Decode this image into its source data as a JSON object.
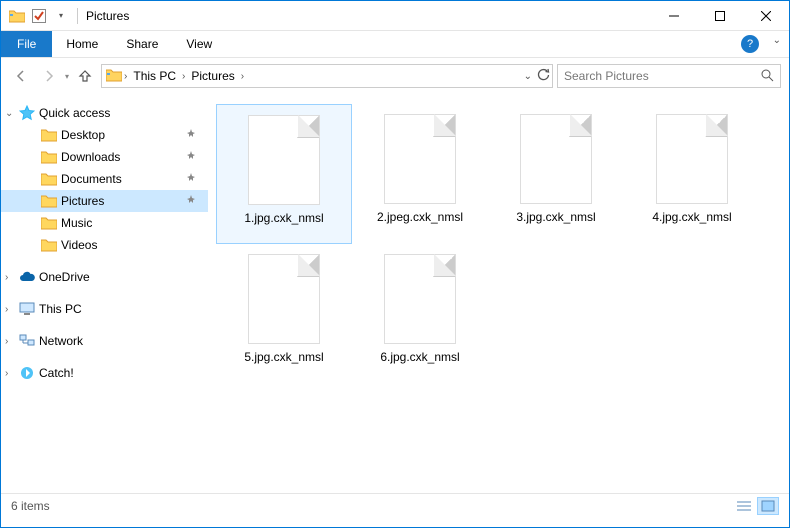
{
  "window": {
    "title": "Pictures"
  },
  "ribbon": {
    "file": "File",
    "tabs": [
      "Home",
      "Share",
      "View"
    ]
  },
  "address": {
    "crumbs": [
      "This PC",
      "Pictures"
    ]
  },
  "search": {
    "placeholder": "Search Pictures"
  },
  "sidebar": {
    "quick_access": "Quick access",
    "quick_items": [
      {
        "label": "Desktop",
        "pinned": true
      },
      {
        "label": "Downloads",
        "pinned": true
      },
      {
        "label": "Documents",
        "pinned": true
      },
      {
        "label": "Pictures",
        "pinned": true,
        "selected": true
      },
      {
        "label": "Music",
        "pinned": false
      },
      {
        "label": "Videos",
        "pinned": false
      }
    ],
    "onedrive": "OneDrive",
    "this_pc": "This PC",
    "network": "Network",
    "catch": "Catch!"
  },
  "files": [
    {
      "name": "1.jpg.cxk_nmsl",
      "selected": true
    },
    {
      "name": "2.jpeg.cxk_nmsl"
    },
    {
      "name": "3.jpg.cxk_nmsl"
    },
    {
      "name": "4.jpg.cxk_nmsl"
    },
    {
      "name": "5.jpg.cxk_nmsl"
    },
    {
      "name": "6.jpg.cxk_nmsl"
    }
  ],
  "status": {
    "count_label": "6 items"
  }
}
